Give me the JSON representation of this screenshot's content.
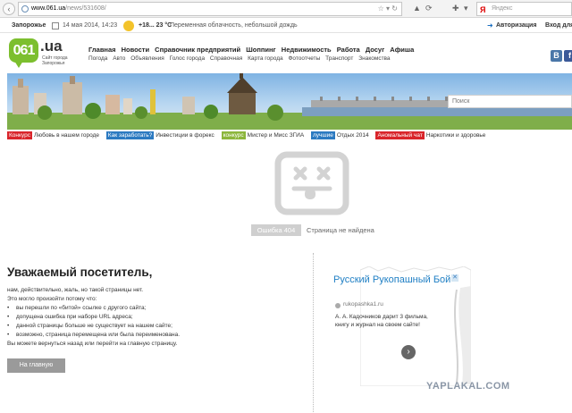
{
  "browser": {
    "url_host": "www.061.ua",
    "url_path": "/news/531608/",
    "search_label": "Яндекс"
  },
  "infobar": {
    "city": "Запорожье",
    "date": "14 мая 2014, 14:23",
    "temperature": "+18... 23 °C",
    "weather": "Переменная облачность, небольшой дождь",
    "login": "Авторизация",
    "register": "Вход для"
  },
  "logo": {
    "number": "061",
    "domain": ".ua",
    "tagline": "Сайт города Запорожья"
  },
  "nav": {
    "main": [
      "Главная",
      "Новости",
      "Справочник предприятий",
      "Шоппинг",
      "Недвижимость",
      "Работа",
      "Досуг",
      "Афиша"
    ],
    "sub": [
      "Погода",
      "Авто",
      "Объявления",
      "Голос города",
      "Справочная",
      "Карта города",
      "Фотоотчеты",
      "Транспорт",
      "Знакомства"
    ]
  },
  "social": {
    "vk": "В",
    "fb": "f"
  },
  "search": {
    "placeholder": "Поиск"
  },
  "tags": [
    {
      "label": "Конкурс",
      "text": "Любовь в нашем городе",
      "color": "#d9252b"
    },
    {
      "label": "Как заработать?",
      "text": "Инвестиции в форекс",
      "color": "#2c7ac1"
    },
    {
      "label": "конкурс",
      "text": "Мистер и Мисс ЗГИА",
      "color": "#8cb63c"
    },
    {
      "label": "лучшие",
      "text": "Отдых 2014",
      "color": "#2c7ac1"
    },
    {
      "label": "Аномальный чат",
      "text": "Наркотики и здоровье",
      "color": "#d9252b"
    }
  ],
  "error": {
    "code": "Ошибка 404",
    "text": "Страница не найдена"
  },
  "message": {
    "title": "Уважаемый посетитель,",
    "line1": "нам, действительно, жаль, но такой страницы нет.",
    "line2": "Это могло произойти потому что:",
    "reasons": [
      "вы перешли по «битой» ссылке с другого сайта;",
      "допущена ошибка при наборе URL адреса;",
      "данной страницы больше не существует на нашем сайте;",
      "возможно, страница перемещена или была переименована."
    ],
    "back_text": "Вы можете вернуться назад или перейти на главную страницу.",
    "home_button": "На главную"
  },
  "ad": {
    "title": "Русский Рукопашный Бой",
    "site": "rukopashka1.ru",
    "text": "А. А. Кадочников дарит 3 фильма, книгу и журнал на своем сайте!"
  },
  "watermark": "YAPLAKAL.COM"
}
